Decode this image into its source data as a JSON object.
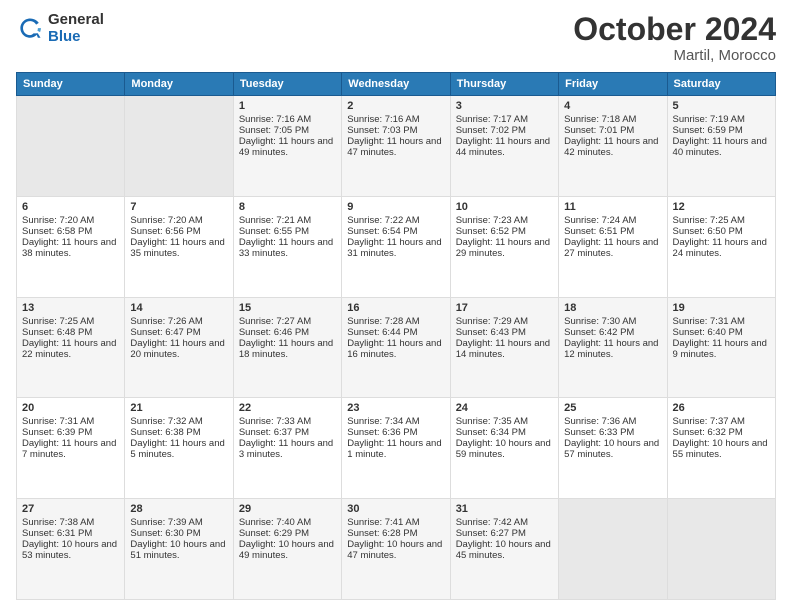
{
  "logo": {
    "general": "General",
    "blue": "Blue"
  },
  "title": "October 2024",
  "location": "Martil, Morocco",
  "days_header": [
    "Sunday",
    "Monday",
    "Tuesday",
    "Wednesday",
    "Thursday",
    "Friday",
    "Saturday"
  ],
  "weeks": [
    [
      {
        "num": "",
        "sunrise": "",
        "sunset": "",
        "daylight": ""
      },
      {
        "num": "",
        "sunrise": "",
        "sunset": "",
        "daylight": ""
      },
      {
        "num": "1",
        "sunrise": "Sunrise: 7:16 AM",
        "sunset": "Sunset: 7:05 PM",
        "daylight": "Daylight: 11 hours and 49 minutes."
      },
      {
        "num": "2",
        "sunrise": "Sunrise: 7:16 AM",
        "sunset": "Sunset: 7:03 PM",
        "daylight": "Daylight: 11 hours and 47 minutes."
      },
      {
        "num": "3",
        "sunrise": "Sunrise: 7:17 AM",
        "sunset": "Sunset: 7:02 PM",
        "daylight": "Daylight: 11 hours and 44 minutes."
      },
      {
        "num": "4",
        "sunrise": "Sunrise: 7:18 AM",
        "sunset": "Sunset: 7:01 PM",
        "daylight": "Daylight: 11 hours and 42 minutes."
      },
      {
        "num": "5",
        "sunrise": "Sunrise: 7:19 AM",
        "sunset": "Sunset: 6:59 PM",
        "daylight": "Daylight: 11 hours and 40 minutes."
      }
    ],
    [
      {
        "num": "6",
        "sunrise": "Sunrise: 7:20 AM",
        "sunset": "Sunset: 6:58 PM",
        "daylight": "Daylight: 11 hours and 38 minutes."
      },
      {
        "num": "7",
        "sunrise": "Sunrise: 7:20 AM",
        "sunset": "Sunset: 6:56 PM",
        "daylight": "Daylight: 11 hours and 35 minutes."
      },
      {
        "num": "8",
        "sunrise": "Sunrise: 7:21 AM",
        "sunset": "Sunset: 6:55 PM",
        "daylight": "Daylight: 11 hours and 33 minutes."
      },
      {
        "num": "9",
        "sunrise": "Sunrise: 7:22 AM",
        "sunset": "Sunset: 6:54 PM",
        "daylight": "Daylight: 11 hours and 31 minutes."
      },
      {
        "num": "10",
        "sunrise": "Sunrise: 7:23 AM",
        "sunset": "Sunset: 6:52 PM",
        "daylight": "Daylight: 11 hours and 29 minutes."
      },
      {
        "num": "11",
        "sunrise": "Sunrise: 7:24 AM",
        "sunset": "Sunset: 6:51 PM",
        "daylight": "Daylight: 11 hours and 27 minutes."
      },
      {
        "num": "12",
        "sunrise": "Sunrise: 7:25 AM",
        "sunset": "Sunset: 6:50 PM",
        "daylight": "Daylight: 11 hours and 24 minutes."
      }
    ],
    [
      {
        "num": "13",
        "sunrise": "Sunrise: 7:25 AM",
        "sunset": "Sunset: 6:48 PM",
        "daylight": "Daylight: 11 hours and 22 minutes."
      },
      {
        "num": "14",
        "sunrise": "Sunrise: 7:26 AM",
        "sunset": "Sunset: 6:47 PM",
        "daylight": "Daylight: 11 hours and 20 minutes."
      },
      {
        "num": "15",
        "sunrise": "Sunrise: 7:27 AM",
        "sunset": "Sunset: 6:46 PM",
        "daylight": "Daylight: 11 hours and 18 minutes."
      },
      {
        "num": "16",
        "sunrise": "Sunrise: 7:28 AM",
        "sunset": "Sunset: 6:44 PM",
        "daylight": "Daylight: 11 hours and 16 minutes."
      },
      {
        "num": "17",
        "sunrise": "Sunrise: 7:29 AM",
        "sunset": "Sunset: 6:43 PM",
        "daylight": "Daylight: 11 hours and 14 minutes."
      },
      {
        "num": "18",
        "sunrise": "Sunrise: 7:30 AM",
        "sunset": "Sunset: 6:42 PM",
        "daylight": "Daylight: 11 hours and 12 minutes."
      },
      {
        "num": "19",
        "sunrise": "Sunrise: 7:31 AM",
        "sunset": "Sunset: 6:40 PM",
        "daylight": "Daylight: 11 hours and 9 minutes."
      }
    ],
    [
      {
        "num": "20",
        "sunrise": "Sunrise: 7:31 AM",
        "sunset": "Sunset: 6:39 PM",
        "daylight": "Daylight: 11 hours and 7 minutes."
      },
      {
        "num": "21",
        "sunrise": "Sunrise: 7:32 AM",
        "sunset": "Sunset: 6:38 PM",
        "daylight": "Daylight: 11 hours and 5 minutes."
      },
      {
        "num": "22",
        "sunrise": "Sunrise: 7:33 AM",
        "sunset": "Sunset: 6:37 PM",
        "daylight": "Daylight: 11 hours and 3 minutes."
      },
      {
        "num": "23",
        "sunrise": "Sunrise: 7:34 AM",
        "sunset": "Sunset: 6:36 PM",
        "daylight": "Daylight: 11 hours and 1 minute."
      },
      {
        "num": "24",
        "sunrise": "Sunrise: 7:35 AM",
        "sunset": "Sunset: 6:34 PM",
        "daylight": "Daylight: 10 hours and 59 minutes."
      },
      {
        "num": "25",
        "sunrise": "Sunrise: 7:36 AM",
        "sunset": "Sunset: 6:33 PM",
        "daylight": "Daylight: 10 hours and 57 minutes."
      },
      {
        "num": "26",
        "sunrise": "Sunrise: 7:37 AM",
        "sunset": "Sunset: 6:32 PM",
        "daylight": "Daylight: 10 hours and 55 minutes."
      }
    ],
    [
      {
        "num": "27",
        "sunrise": "Sunrise: 7:38 AM",
        "sunset": "Sunset: 6:31 PM",
        "daylight": "Daylight: 10 hours and 53 minutes."
      },
      {
        "num": "28",
        "sunrise": "Sunrise: 7:39 AM",
        "sunset": "Sunset: 6:30 PM",
        "daylight": "Daylight: 10 hours and 51 minutes."
      },
      {
        "num": "29",
        "sunrise": "Sunrise: 7:40 AM",
        "sunset": "Sunset: 6:29 PM",
        "daylight": "Daylight: 10 hours and 49 minutes."
      },
      {
        "num": "30",
        "sunrise": "Sunrise: 7:41 AM",
        "sunset": "Sunset: 6:28 PM",
        "daylight": "Daylight: 10 hours and 47 minutes."
      },
      {
        "num": "31",
        "sunrise": "Sunrise: 7:42 AM",
        "sunset": "Sunset: 6:27 PM",
        "daylight": "Daylight: 10 hours and 45 minutes."
      },
      {
        "num": "",
        "sunrise": "",
        "sunset": "",
        "daylight": ""
      },
      {
        "num": "",
        "sunrise": "",
        "sunset": "",
        "daylight": ""
      }
    ]
  ]
}
